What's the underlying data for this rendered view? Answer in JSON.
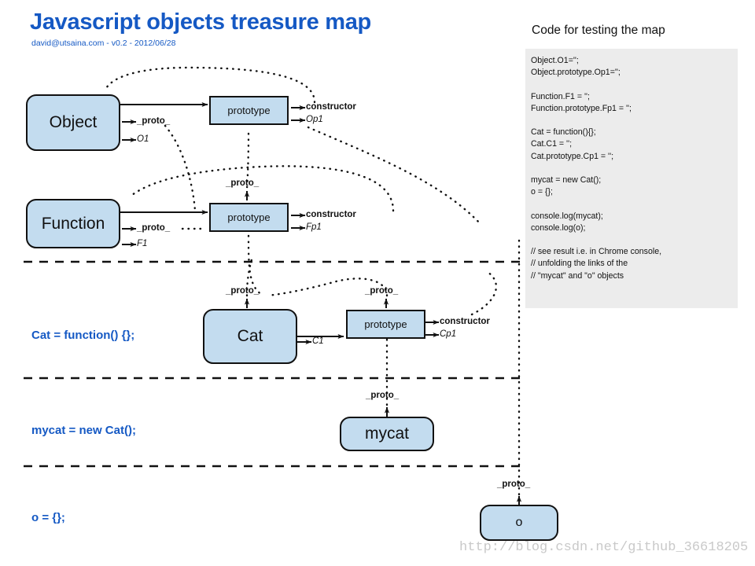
{
  "header": {
    "title": "Javascript objects treasure map",
    "subtitle": "david@utsaina.com - v0.2 - 2012/06/28",
    "title_color": "#1559c4"
  },
  "code_panel": {
    "heading": "Code for testing the map",
    "background": "#ececec",
    "code": "Object.O1='';\nObject.prototype.Op1='';\n\nFunction.F1 = '';\nFunction.prototype.Fp1 = '';\n\nCat = function(){};\nCat.C1 = '';\nCat.prototype.Cp1 = '';\n\nmycat = new Cat();\no = {};\n\nconsole.log(mycat);\nconsole.log(o);\n\n// see result i.e. in Chrome console,\n// unfolding the links of the\n// \"mycat\" and \"o\" objects"
  },
  "diagram": {
    "node_fill": "#c3dcef",
    "node_stroke": "#111111",
    "nodes": {
      "object": "Object",
      "object_prototype": "prototype",
      "function": "Function",
      "function_prototype": "prototype",
      "cat": "Cat",
      "cat_prototype": "prototype",
      "mycat": "mycat",
      "o": "o"
    },
    "labels": {
      "object_proto": "_proto_",
      "object_o1": "O1",
      "object_proto_constructor": "constructor",
      "object_proto_op1": "Op1",
      "function_proto": "_proto_",
      "function_f1": "F1",
      "function_prototype_proto": "_proto_",
      "function_proto_constructor": "constructor",
      "function_proto_fp1": "Fp1",
      "cat_proto": "_proto_",
      "cat_c1": "C1",
      "cat_prototype_proto": "_proto_",
      "cat_proto_constructor": "constructor",
      "cat_proto_cp1": "Cp1",
      "mycat_proto": "_proto_",
      "o_proto": "_proto_"
    },
    "captions": [
      {
        "text": "Cat = function() {};",
        "color": "#1559c4"
      },
      {
        "text": "mycat = new Cat();",
        "color": "#1559c4"
      },
      {
        "text": "o = {};",
        "color": "#1559c4"
      }
    ]
  },
  "watermark": {
    "text": "http://blog.csdn.net/github_36618205",
    "color": "#c9c9c9"
  }
}
